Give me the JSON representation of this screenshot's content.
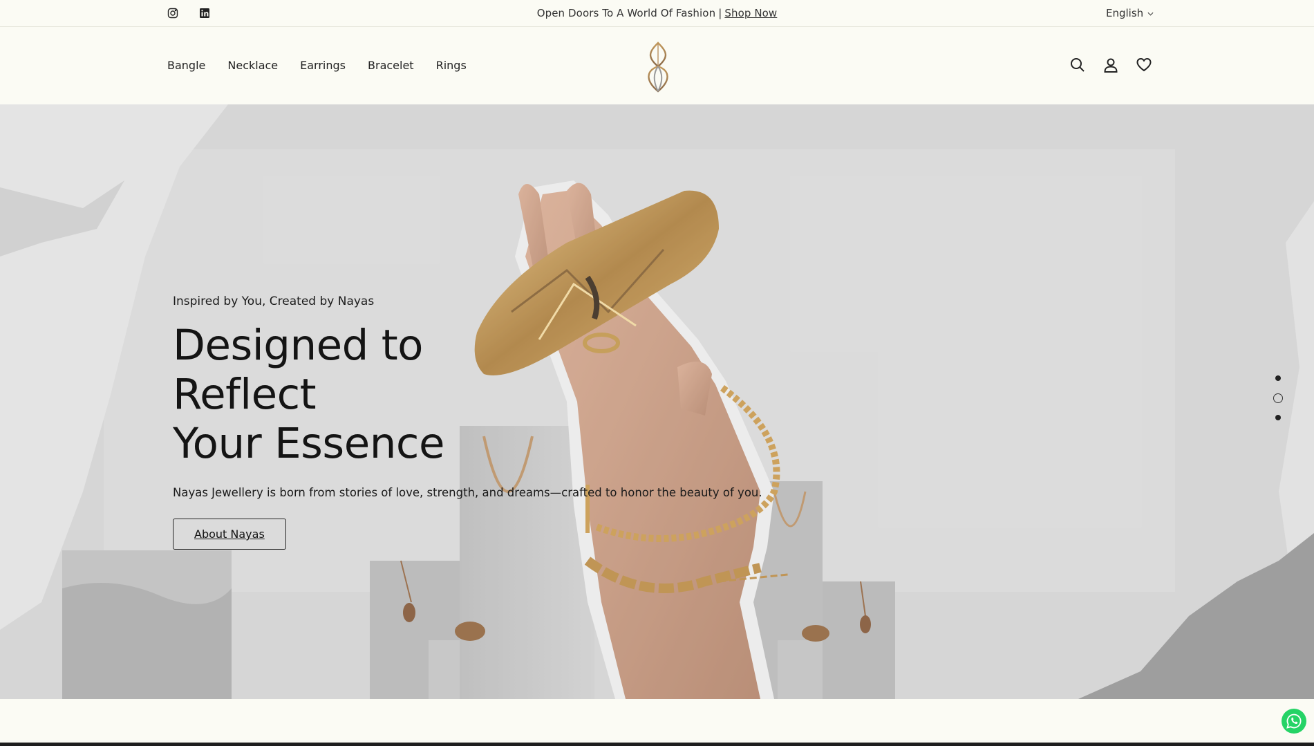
{
  "topbar": {
    "social": [
      {
        "icon": "instagram-icon"
      },
      {
        "icon": "linkedin-icon"
      }
    ],
    "announcement_text": "Open Doors To A World Of Fashion",
    "announcement_separator": "|",
    "announcement_link": "Shop Now",
    "language": "English"
  },
  "header": {
    "nav": [
      "Bangle",
      "Necklace",
      "Earrings",
      "Bracelet",
      "Rings"
    ],
    "actions": [
      "search-icon",
      "account-icon",
      "wishlist-icon"
    ]
  },
  "hero": {
    "eyebrow": "Inspired by You, Created by Nayas",
    "headline_line1": "Designed to Reflect",
    "headline_line2": "Your Essence",
    "description": "Nayas Jewellery is born from stories of love, strength, and dreams—crafted to honor the beauty of you.",
    "cta_label": "About Nayas",
    "slides_total": 3,
    "active_slide": 2
  },
  "colors": {
    "page_bg": "#fbfbf4",
    "hero_bg": "#d6d6d6",
    "gold": "#b98a3c",
    "skin": "#c99a7c",
    "whatsapp": "#25d366"
  }
}
